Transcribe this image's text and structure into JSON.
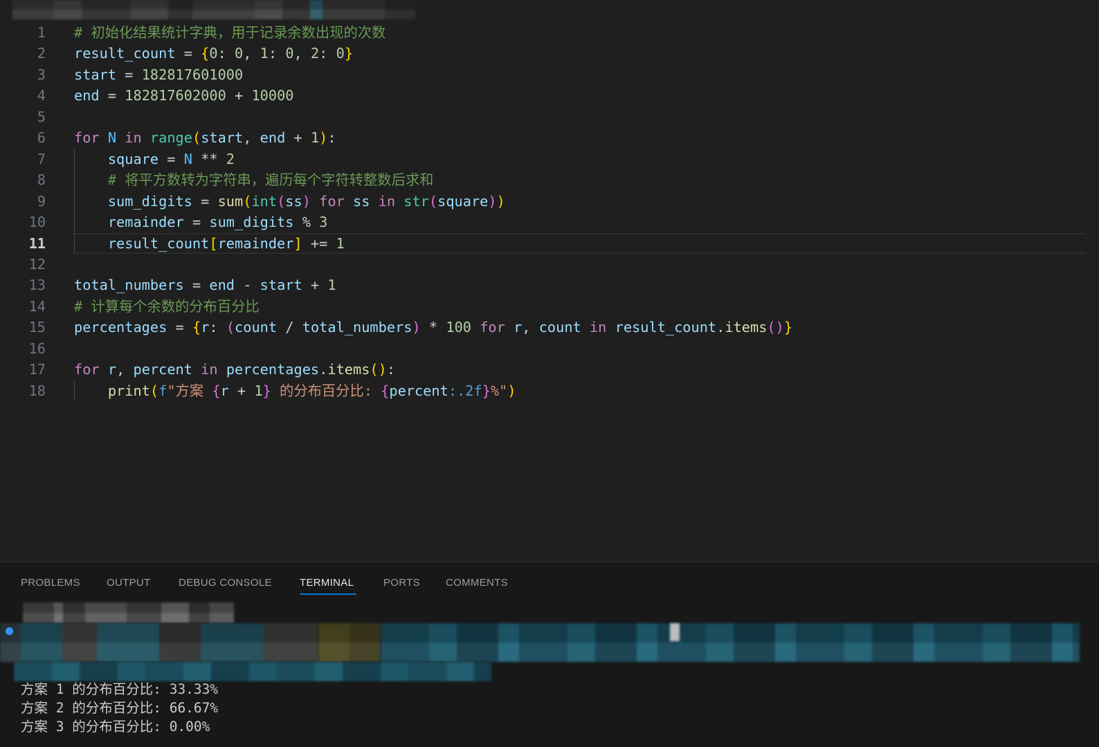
{
  "theme": {
    "accent": "#0078d4",
    "tokens": {
      "c": "#6a9955",
      "v": "#9cdcfe",
      "n": "#b5cea8",
      "k": "#c586c0",
      "o": "#cccccc",
      "f": "#dcdcaa",
      "b": "#4ec9b0",
      "C": "#4fc1ff",
      "s": "#ce9178",
      "p": "#569cd6",
      "y": "#ffd700",
      "m": "#da70d6"
    }
  },
  "editor": {
    "current_line": 11,
    "lines": [
      {
        "n": "1",
        "indent": 0,
        "tokens": [
          [
            "# 初始化结果统计字典，用于记录余数出现的次数",
            "c"
          ]
        ]
      },
      {
        "n": "2",
        "indent": 0,
        "tokens": [
          [
            "result_count",
            "v"
          ],
          [
            " = ",
            "o"
          ],
          [
            "{",
            "y"
          ],
          [
            "0",
            "n"
          ],
          [
            ": ",
            "o"
          ],
          [
            "0",
            "n"
          ],
          [
            ", ",
            "o"
          ],
          [
            "1",
            "n"
          ],
          [
            ": ",
            "o"
          ],
          [
            "0",
            "n"
          ],
          [
            ", ",
            "o"
          ],
          [
            "2",
            "n"
          ],
          [
            ": ",
            "o"
          ],
          [
            "0",
            "n"
          ],
          [
            "}",
            "y"
          ]
        ]
      },
      {
        "n": "3",
        "indent": 0,
        "tokens": [
          [
            "start",
            "v"
          ],
          [
            " = ",
            "o"
          ],
          [
            "182817601000",
            "n"
          ]
        ]
      },
      {
        "n": "4",
        "indent": 0,
        "tokens": [
          [
            "end",
            "v"
          ],
          [
            " = ",
            "o"
          ],
          [
            "182817602000",
            "n"
          ],
          [
            " + ",
            "o"
          ],
          [
            "10000",
            "n"
          ]
        ]
      },
      {
        "n": "5",
        "indent": 0,
        "tokens": []
      },
      {
        "n": "6",
        "indent": 0,
        "tokens": [
          [
            "for ",
            "k"
          ],
          [
            "N",
            "C"
          ],
          [
            " in ",
            "k"
          ],
          [
            "range",
            "b"
          ],
          [
            "(",
            "y"
          ],
          [
            "start",
            "v"
          ],
          [
            ", ",
            "o"
          ],
          [
            "end",
            "v"
          ],
          [
            " + ",
            "o"
          ],
          [
            "1",
            "n"
          ],
          [
            ")",
            "y"
          ],
          [
            ":",
            "o"
          ]
        ]
      },
      {
        "n": "7",
        "indent": 1,
        "tokens": [
          [
            "square",
            "v"
          ],
          [
            " = ",
            "o"
          ],
          [
            "N",
            "C"
          ],
          [
            " ** ",
            "o"
          ],
          [
            "2",
            "n"
          ]
        ]
      },
      {
        "n": "8",
        "indent": 1,
        "tokens": [
          [
            "# 将平方数转为字符串，遍历每个字符转整数后求和",
            "c"
          ]
        ]
      },
      {
        "n": "9",
        "indent": 1,
        "tokens": [
          [
            "sum_digits",
            "v"
          ],
          [
            " = ",
            "o"
          ],
          [
            "sum",
            "f"
          ],
          [
            "(",
            "y"
          ],
          [
            "int",
            "b"
          ],
          [
            "(",
            "m"
          ],
          [
            "ss",
            "v"
          ],
          [
            ")",
            "m"
          ],
          [
            " for ",
            "k"
          ],
          [
            "ss",
            "v"
          ],
          [
            " in ",
            "k"
          ],
          [
            "str",
            "b"
          ],
          [
            "(",
            "m"
          ],
          [
            "square",
            "v"
          ],
          [
            ")",
            "m"
          ],
          [
            ")",
            "y"
          ]
        ]
      },
      {
        "n": "10",
        "indent": 1,
        "tokens": [
          [
            "remainder",
            "v"
          ],
          [
            " = ",
            "o"
          ],
          [
            "sum_digits",
            "v"
          ],
          [
            " % ",
            "o"
          ],
          [
            "3",
            "n"
          ]
        ]
      },
      {
        "n": "11",
        "indent": 1,
        "tokens": [
          [
            "result_count",
            "v"
          ],
          [
            "[",
            "y"
          ],
          [
            "remainder",
            "v"
          ],
          [
            "]",
            "y"
          ],
          [
            " += ",
            "o"
          ],
          [
            "1",
            "n"
          ]
        ]
      },
      {
        "n": "12",
        "indent": 0,
        "tokens": []
      },
      {
        "n": "13",
        "indent": 0,
        "tokens": [
          [
            "total_numbers",
            "v"
          ],
          [
            " = ",
            "o"
          ],
          [
            "end",
            "v"
          ],
          [
            " - ",
            "o"
          ],
          [
            "start",
            "v"
          ],
          [
            " + ",
            "o"
          ],
          [
            "1",
            "n"
          ]
        ]
      },
      {
        "n": "14",
        "indent": 0,
        "tokens": [
          [
            "# 计算每个余数的分布百分比",
            "c"
          ]
        ]
      },
      {
        "n": "15",
        "indent": 0,
        "tokens": [
          [
            "percentages",
            "v"
          ],
          [
            " = ",
            "o"
          ],
          [
            "{",
            "y"
          ],
          [
            "r",
            "v"
          ],
          [
            ": ",
            "o"
          ],
          [
            "(",
            "m"
          ],
          [
            "count",
            "v"
          ],
          [
            " / ",
            "o"
          ],
          [
            "total_numbers",
            "v"
          ],
          [
            ")",
            "m"
          ],
          [
            " * ",
            "o"
          ],
          [
            "100",
            "n"
          ],
          [
            " for ",
            "k"
          ],
          [
            "r",
            "v"
          ],
          [
            ", ",
            "o"
          ],
          [
            "count",
            "v"
          ],
          [
            " in ",
            "k"
          ],
          [
            "result_count",
            "v"
          ],
          [
            ".",
            "o"
          ],
          [
            "items",
            "f"
          ],
          [
            "()",
            "m"
          ],
          [
            "}",
            "y"
          ]
        ]
      },
      {
        "n": "16",
        "indent": 0,
        "tokens": []
      },
      {
        "n": "17",
        "indent": 0,
        "tokens": [
          [
            "for ",
            "k"
          ],
          [
            "r",
            "v"
          ],
          [
            ", ",
            "o"
          ],
          [
            "percent",
            "v"
          ],
          [
            " in ",
            "k"
          ],
          [
            "percentages",
            "v"
          ],
          [
            ".",
            "o"
          ],
          [
            "items",
            "f"
          ],
          [
            "()",
            "y"
          ],
          [
            ":",
            "o"
          ]
        ]
      },
      {
        "n": "18",
        "indent": 1,
        "tokens": [
          [
            "print",
            "f"
          ],
          [
            "(",
            "y"
          ],
          [
            "f",
            "p"
          ],
          [
            "\"方案 ",
            "s"
          ],
          [
            "{",
            "m"
          ],
          [
            "r",
            "v"
          ],
          [
            " + ",
            "o"
          ],
          [
            "1",
            "n"
          ],
          [
            "}",
            "m"
          ],
          [
            " 的分布百分比: ",
            "s"
          ],
          [
            "{",
            "m"
          ],
          [
            "percent",
            "v"
          ],
          [
            ":.2f",
            "p"
          ],
          [
            "}",
            "m"
          ],
          [
            "%\"",
            "s"
          ],
          [
            ")",
            "y"
          ]
        ]
      }
    ]
  },
  "panel": {
    "tabs": [
      {
        "label": "PROBLEMS",
        "active": false
      },
      {
        "label": "OUTPUT",
        "active": false
      },
      {
        "label": "DEBUG CONSOLE",
        "active": false
      },
      {
        "label": "TERMINAL",
        "active": true
      },
      {
        "label": "PORTS",
        "active": false
      },
      {
        "label": "COMMENTS",
        "active": false
      }
    ],
    "terminal": {
      "output": [
        "方案 1 的分布百分比: 33.33%",
        "方案 2 的分布百分比: 66.67%",
        "方案 3 的分布百分比: 0.00%"
      ]
    }
  }
}
